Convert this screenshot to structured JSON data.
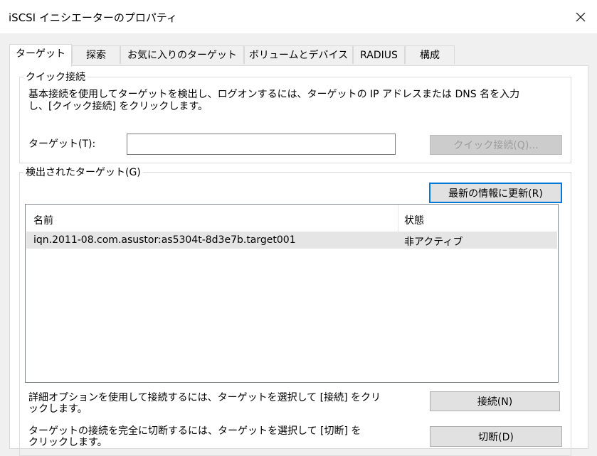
{
  "window": {
    "title": "iSCSI イニシエーターのプロパティ"
  },
  "tabs": [
    {
      "label": "ターゲット"
    },
    {
      "label": "探索"
    },
    {
      "label": "お気に入りのターゲット"
    },
    {
      "label": "ボリュームとデバイス"
    },
    {
      "label": "RADIUS"
    },
    {
      "label": "構成"
    }
  ],
  "quick_connect": {
    "group_label": "クイック接続",
    "description_line1": "基本接続を使用してターゲットを検出し、ログオンするには、ターゲットの IP アドレスまたは DNS 名を入力",
    "description_line2": "し、[クイック接続] をクリックします。",
    "target_label": "ターゲット(T):",
    "target_value": "",
    "button_label": "クイック接続(Q)..."
  },
  "discovered": {
    "group_label": "検出されたターゲット(G)",
    "refresh_label": "最新の情報に更新(R)",
    "columns": {
      "name": "名前",
      "status": "状態"
    },
    "rows": [
      {
        "name": "iqn.2011-08.com.asustor:as5304t-8d3e7b.target001",
        "status": "非アクティブ"
      }
    ],
    "connect_text_line1": "詳細オプションを使用して接続するには、ターゲットを選択して [接続] をクリ",
    "connect_text_line2": "ックします。",
    "connect_label": "接続(N)",
    "disconnect_text_line1": "ターゲットの接続を完全に切断するには、ターゲットを選択して [切断] を",
    "disconnect_text_line2": "クリックします。",
    "disconnect_label": "切断(D)"
  },
  "icons": {
    "close": "close-icon"
  }
}
